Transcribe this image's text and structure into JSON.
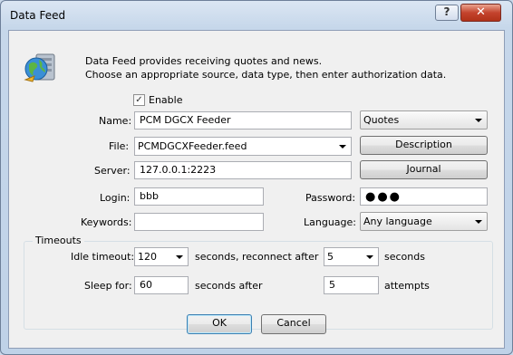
{
  "window": {
    "title": "Data Feed",
    "help_label": "?",
    "close_label": "✕"
  },
  "header": {
    "icon": "globe-server-icon",
    "line1": "Data Feed provides receiving quotes and news.",
    "line2": "Choose an appropriate source, data type, then enter authorization data."
  },
  "enable": {
    "label": "Enable",
    "checked": true,
    "mark": "✓"
  },
  "form": {
    "name_label": "Name:",
    "name_value": "PCM DGCX Feeder",
    "type_value": "Quotes",
    "file_label": "File:",
    "file_value": "PCMDGCXFeeder.feed",
    "description_button": "Description",
    "server_label": "Server:",
    "server_value": "127.0.0.1:2223",
    "journal_button": "Journal",
    "login_label": "Login:",
    "login_value": "bbb",
    "password_label": "Password:",
    "password_value": "●●●",
    "keywords_label": "Keywords:",
    "keywords_value": "",
    "language_label": "Language:",
    "language_value": "Any language"
  },
  "timeouts": {
    "title": "Timeouts",
    "idle_label": "Idle timeout:",
    "idle_value": "120",
    "idle_suffix": "seconds, reconnect after",
    "reconnect_value": "5",
    "reconnect_suffix": "seconds",
    "sleep_label": "Sleep for:",
    "sleep_value": "60",
    "sleep_suffix": "seconds after",
    "attempts_value": "5",
    "attempts_suffix": "attempts"
  },
  "buttons": {
    "ok": "OK",
    "cancel": "Cancel"
  }
}
